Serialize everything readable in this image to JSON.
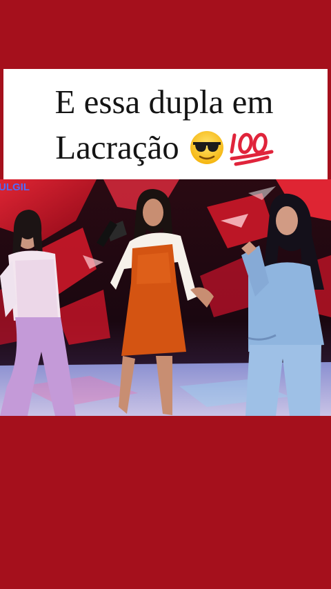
{
  "caption": {
    "line1": "E essa dupla em",
    "line2": "Lacração",
    "emoji_sunglasses": "sunglasses-face-emoji",
    "emoji_hundred": "hundred-points-emoji"
  },
  "video": {
    "watermark": "ULGIL",
    "scene": "three-women-performing-on-tv-stage"
  },
  "colors": {
    "background": "#a5101c",
    "caption_background": "#ffffff",
    "caption_text": "#141414"
  }
}
